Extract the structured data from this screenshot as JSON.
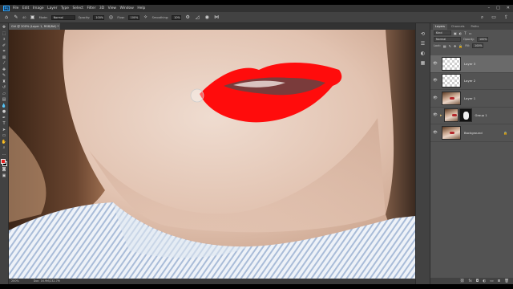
{
  "menu": {
    "logo": "Ps",
    "items": [
      "File",
      "Edit",
      "Image",
      "Layer",
      "Type",
      "Select",
      "Filter",
      "3D",
      "View",
      "Window",
      "Help"
    ]
  },
  "options": {
    "mode_label": "Mode:",
    "mode_value": "Normal",
    "opacity_label": "Opacity:",
    "opacity_value": "100%",
    "flow_label": "Flow:",
    "flow_value": "100%",
    "smoothing_label": "Smoothing:",
    "smoothing_value": "10%",
    "brush_size": "40"
  },
  "document": {
    "tab_title": "Girl @ 200% (Layer 1, RGB/8#) *",
    "zoom": "200%",
    "doc_size": "Doc: 16.9M/232.7M"
  },
  "colors": {
    "foreground": "#e31e1e",
    "background": "#000000",
    "lip_paint": "#ff0c0c",
    "accent": "#31a8ff"
  },
  "panel": {
    "tabs": [
      "Layers",
      "Channels",
      "Paths"
    ],
    "active_tab": "Layers",
    "filter_label": "Kind",
    "blend_mode": "Normal",
    "opacity_label": "Opacity:",
    "opacity_value": "100%",
    "lock_label": "Lock:",
    "fill_label": "Fill:",
    "fill_value": "100%"
  },
  "layers": [
    {
      "name": "Layer 3",
      "thumb": "checker",
      "selected": true
    },
    {
      "name": "Layer 2",
      "thumb": "checker",
      "selected": false
    },
    {
      "name": "Layer 1",
      "thumb": "photo",
      "selected": false
    },
    {
      "name": "Group 1",
      "thumb": "photo-mask",
      "selected": false
    },
    {
      "name": "Background",
      "thumb": "photo",
      "selected": false,
      "locked": true
    }
  ],
  "icons": {
    "eye": "👁",
    "folder": "▸",
    "lock": "🔒"
  }
}
